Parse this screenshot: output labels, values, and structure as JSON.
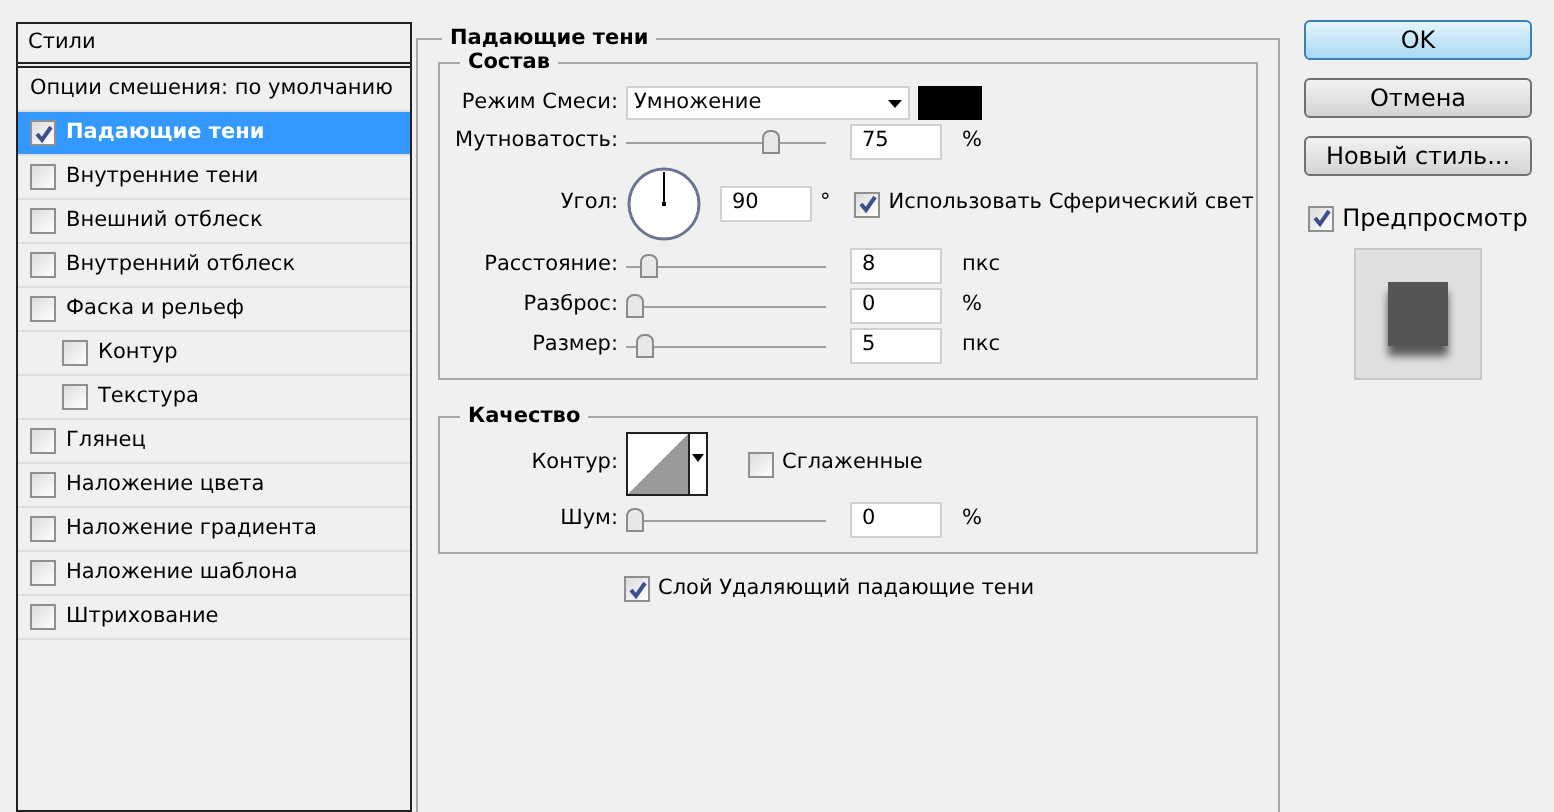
{
  "sidebar": {
    "title": "Стили",
    "items": [
      {
        "label": "Опции смешения: по умолчанию",
        "kind": "header",
        "selected": false
      },
      {
        "label": "Падающие тени",
        "kind": "check",
        "checked": true,
        "selected": true
      },
      {
        "label": "Внутренние тени",
        "kind": "check",
        "checked": false,
        "selected": false
      },
      {
        "label": "Внешний отблеск",
        "kind": "check",
        "checked": false,
        "selected": false
      },
      {
        "label": "Внутренний отблеск",
        "kind": "check",
        "checked": false,
        "selected": false
      },
      {
        "label": "Фаска и рельеф",
        "kind": "check",
        "checked": false,
        "selected": false,
        "children": [
          {
            "label": "Контур",
            "kind": "check",
            "checked": false,
            "selected": false
          },
          {
            "label": "Текстура",
            "kind": "check",
            "checked": false,
            "selected": false
          }
        ]
      },
      {
        "label": "Глянец",
        "kind": "check",
        "checked": false,
        "selected": false
      },
      {
        "label": "Наложение цвета",
        "kind": "check",
        "checked": false,
        "selected": false
      },
      {
        "label": "Наложение градиента",
        "kind": "check",
        "checked": false,
        "selected": false
      },
      {
        "label": "Наложение шаблона",
        "kind": "check",
        "checked": false,
        "selected": false
      },
      {
        "label": "Штрихование",
        "kind": "check",
        "checked": false,
        "selected": false
      }
    ]
  },
  "panel": {
    "title": "Падающие тени",
    "structure": {
      "title": "Состав",
      "rows": [
        {
          "kind": "blend",
          "label": "Режим Смеси:",
          "value": "Умножение",
          "color": "#000000"
        },
        {
          "kind": "slider",
          "label": "Мутноватость:",
          "level": 0.75,
          "value": "75",
          "unit": "%"
        },
        {
          "kind": "angle",
          "label": "Угол:",
          "value": "90",
          "unit": "°",
          "checkbox": {
            "label": "Использовать Сферический свет",
            "checked": true
          }
        },
        {
          "kind": "slider",
          "label": "Расстояние:",
          "level": 0.08,
          "value": "8",
          "unit": "пкс"
        },
        {
          "kind": "slider",
          "label": "Разброс:",
          "level": 0,
          "value": "0",
          "unit": "%"
        },
        {
          "kind": "slider",
          "label": "Размер:",
          "level": 0.05,
          "value": "5",
          "unit": "пкс"
        }
      ]
    },
    "quality": {
      "title": "Качество",
      "contour": {
        "label": "Контур:"
      },
      "antialias": {
        "label": "Сглаженные",
        "checked": false
      },
      "noise": {
        "label": "Шум:",
        "level": 0,
        "value": "0",
        "unit": "%"
      }
    },
    "knockout": {
      "label": "Слой Удаляющий падающие тени",
      "checked": true
    }
  },
  "buttons": [
    {
      "label": "OK",
      "default": true
    },
    {
      "label": "Отмена",
      "default": false
    },
    {
      "label": "Новый стиль...",
      "default": false
    }
  ],
  "preview": {
    "label": "Предпросмотр",
    "checked": true
  }
}
